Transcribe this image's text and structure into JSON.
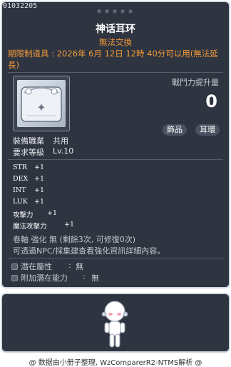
{
  "item": {
    "id": "01032205",
    "stars": "★★★★★",
    "name": "神话耳环",
    "trade": "無法交換",
    "limited": "期限制道具 : 2026年 6月 12日 12時 40分可以用(無法延長)",
    "power_label": "戰鬥力提升量",
    "power_value": "0",
    "tags": [
      "飾品",
      "耳環"
    ]
  },
  "requirements": [
    {
      "label": "裝備職業",
      "value": "共用"
    },
    {
      "label": "要求等級",
      "value": "Lv.10"
    }
  ],
  "stats": [
    {
      "name": "STR",
      "value": "+1"
    },
    {
      "name": "DEX",
      "value": "+1"
    },
    {
      "name": "INT",
      "value": "+1"
    },
    {
      "name": "LUK",
      "value": "+1"
    },
    {
      "name": "攻擊力",
      "value": "+1"
    },
    {
      "name": "魔法攻擊力",
      "value": "+1"
    }
  ],
  "enhance": {
    "line1": "卷軸 強化 無 (剩餘3次, 可修復0次)",
    "line2": "可透過NPC/採集建查看強化資訊詳細內容。"
  },
  "potential": [
    {
      "label": "潛在屬性",
      "sep": ":",
      "value": "無"
    },
    {
      "label": "附加潛在能力",
      "sep": ":",
      "value": "無"
    }
  ],
  "footer": "@ 数据由小册子整理, WzComparerR2-NTMS解析 @",
  "colors": {
    "accent": "#f19a3a",
    "panel": "#2e3440",
    "border": "#cfd6e0"
  }
}
